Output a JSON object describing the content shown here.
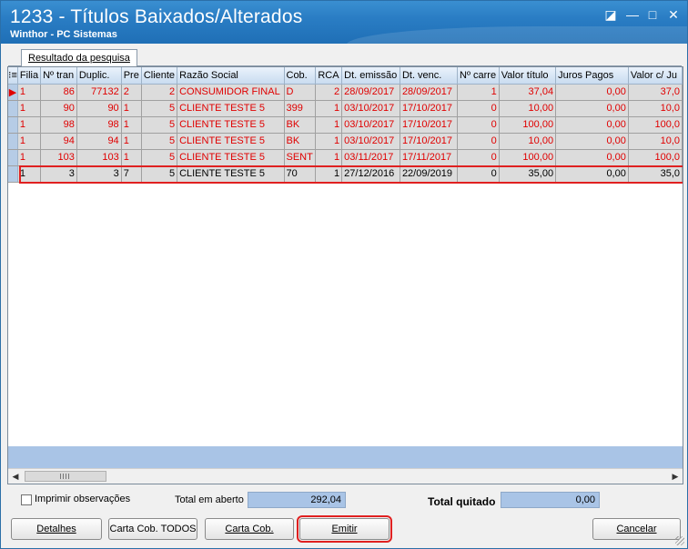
{
  "window": {
    "title": "1233 - Títulos Baixados/Alterados",
    "subtitle": "Winthor - PC Sistemas",
    "restore_glyph": "◪",
    "minimize_glyph": "—",
    "maximize_glyph": "□",
    "close_glyph": "✕"
  },
  "tab": {
    "label": "Resultado da pesquisa"
  },
  "grid": {
    "indicator_header": "⁝≡",
    "columns": [
      "Filia",
      "Nº tran",
      "Duplic.",
      "Pre",
      "Cliente",
      "Razão Social",
      "Cob.",
      "RCA",
      "Dt. emissão",
      "Dt. venc.",
      "Nº carre",
      "Valor título",
      "Juros Pagos",
      "Valor c/ Ju"
    ],
    "current_row_marker": "▶",
    "rows": [
      [
        "1",
        "86",
        "77132",
        "2",
        "2",
        "CONSUMIDOR FINAL",
        "D",
        "2",
        "28/09/2017",
        "28/09/2017",
        "1",
        "37,04",
        "0,00",
        "37,0"
      ],
      [
        "1",
        "90",
        "90",
        "1",
        "5",
        "CLIENTE TESTE 5",
        "399",
        "1",
        "03/10/2017",
        "17/10/2017",
        "0",
        "10,00",
        "0,00",
        "10,0"
      ],
      [
        "1",
        "98",
        "98",
        "1",
        "5",
        "CLIENTE TESTE 5",
        "BK",
        "1",
        "03/10/2017",
        "17/10/2017",
        "0",
        "100,00",
        "0,00",
        "100,0"
      ],
      [
        "1",
        "94",
        "94",
        "1",
        "5",
        "CLIENTE TESTE 5",
        "BK",
        "1",
        "03/10/2017",
        "17/10/2017",
        "0",
        "10,00",
        "0,00",
        "10,0"
      ],
      [
        "1",
        "103",
        "103",
        "1",
        "5",
        "CLIENTE TESTE 5",
        "SENT",
        "1",
        "03/11/2017",
        "17/11/2017",
        "0",
        "100,00",
        "0,00",
        "100,0"
      ],
      [
        "1",
        "3",
        "3",
        "7",
        "5",
        "CLIENTE TESTE 5",
        "70",
        "1",
        "27/12/2016",
        "22/09/2019",
        "0",
        "35,00",
        "0,00",
        "35,0"
      ]
    ],
    "row_colors": [
      "#e00000",
      "#e00000",
      "#e00000",
      "#e00000",
      "#e00000",
      "#000000"
    ]
  },
  "scrollbar": {
    "left_arrow": "◀",
    "right_arrow": "▶"
  },
  "options": {
    "print_obs_label": "Imprimir observações",
    "print_obs_checked": false
  },
  "totals": {
    "open_label": "Total em aberto",
    "open_value": "292,04",
    "paid_label": "Total quitado",
    "paid_value": "0,00"
  },
  "buttons": {
    "details": "Detalhes",
    "carta_todos": "Carta Cob. TODOS",
    "carta": "Carta Cob.",
    "emitir": "Emitir",
    "cancelar": "Cancelar"
  },
  "colors": {
    "accent_red": "#e02020",
    "header_blue": "#2a7dc4",
    "field_blue": "#a9c4e6"
  }
}
